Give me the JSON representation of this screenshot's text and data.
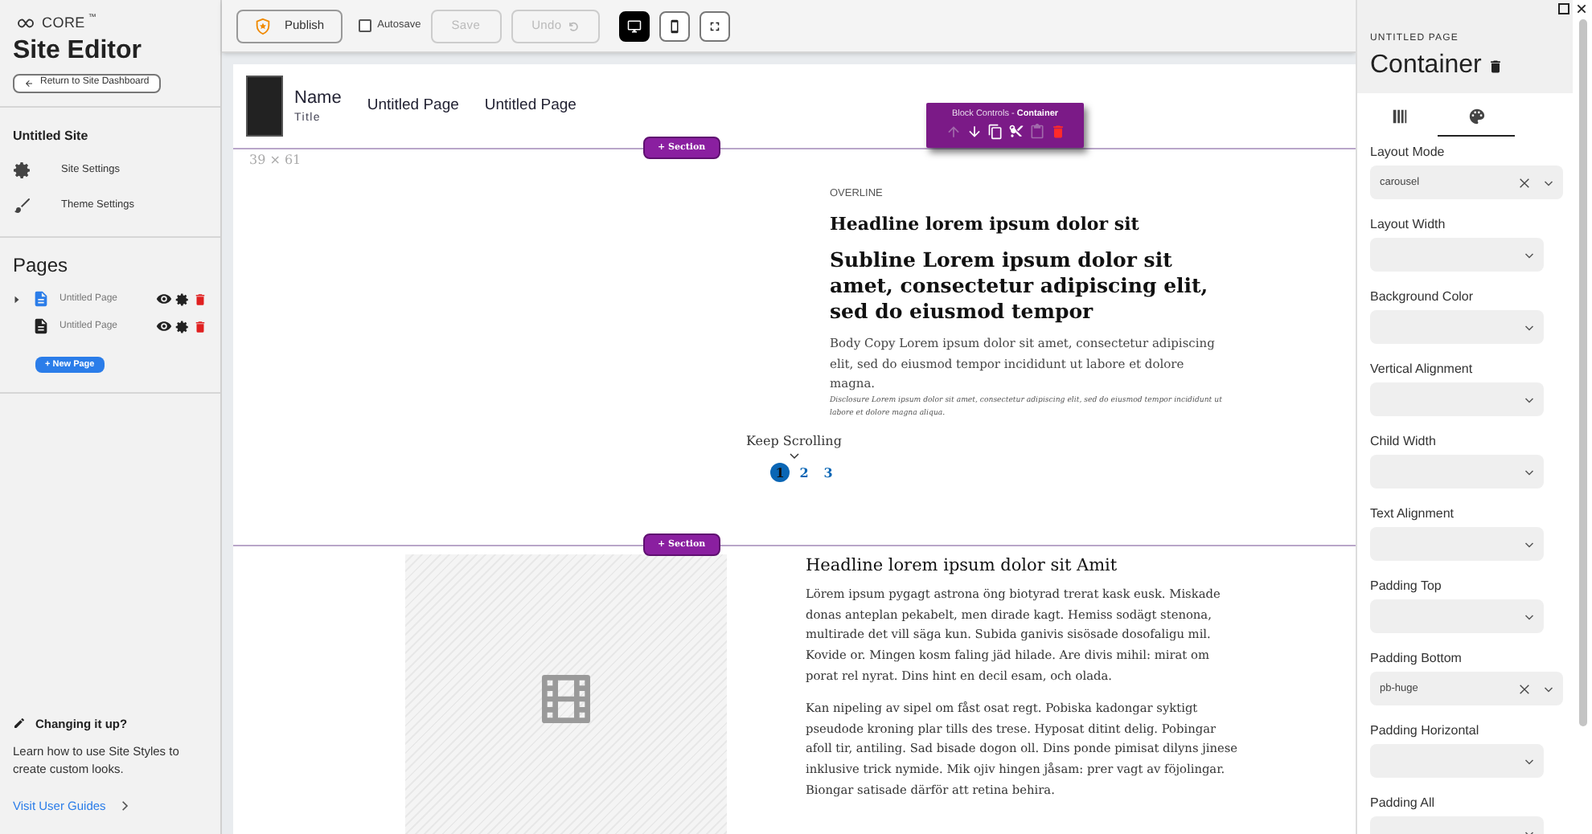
{
  "sidebar": {
    "brand": "CORE",
    "brand_mark": "™",
    "title": "Site Editor",
    "return_button": "Return to Site Dashboard",
    "site_name": "Untitled Site",
    "settings": [
      {
        "kind": "gear",
        "label": "Site Settings"
      },
      {
        "kind": "brush",
        "label": "Theme Settings"
      }
    ],
    "pages_heading": "Pages",
    "pages": [
      {
        "label": "Untitled Page",
        "expandable": true,
        "selected": true
      },
      {
        "label": "Untitled Page",
        "expandable": false,
        "selected": false
      }
    ],
    "new_page_button": "+ New Page",
    "tip": {
      "title": "Changing it up?",
      "body": "Learn how to use Site Styles to create custom looks.",
      "link": "Visit User Guides"
    }
  },
  "toolbar": {
    "publish": "Publish",
    "autosave": {
      "label": "Autosave",
      "checked": false
    },
    "save": {
      "label": "Save",
      "disabled": true
    },
    "undo": {
      "label": "Undo",
      "disabled": true
    },
    "views": [
      {
        "kind": "desktop",
        "selected": true
      },
      {
        "kind": "mobile",
        "selected": false
      },
      {
        "kind": "fullscreen",
        "selected": false
      }
    ]
  },
  "canvas": {
    "header": {
      "name": "Name",
      "subtitle": "Title",
      "nav": [
        "Untitled Page",
        "Untitled Page"
      ]
    },
    "dimensions": "39 × 61",
    "add_section": [
      "+ Section",
      "+ Section"
    ],
    "block_controls": {
      "label": "Block Controls - ",
      "target": "Container",
      "actions": [
        {
          "kind": "up",
          "disabled": true
        },
        {
          "kind": "down",
          "disabled": false
        },
        {
          "kind": "copy",
          "disabled": false
        },
        {
          "kind": "cut",
          "disabled": false
        },
        {
          "kind": "paste",
          "disabled": true
        },
        {
          "kind": "delete",
          "disabled": false
        }
      ]
    },
    "hero": {
      "overline": "OVERLINE",
      "headline": "Headline lorem ipsum dolor sit",
      "subline": "Subline Lorem ipsum dolor sit amet, consectetur adipiscing elit, sed do eiusmod tempor",
      "body": "Body Copy Lorem ipsum dolor sit amet, consectetur adipiscing elit, sed do eiusmod tempor incididunt ut labore et dolore magna.",
      "disclosure": "Disclosure Lorem ipsum dolor sit amet, consectetur adipiscing elit, sed do eiusmod tempor incididunt ut labore et dolore magna aliqua.",
      "keep_scrolling": "Keep Scrolling",
      "pagination": [
        {
          "label": "1",
          "selected": true
        },
        {
          "label": "2",
          "selected": false
        },
        {
          "label": "3",
          "selected": false
        }
      ]
    },
    "article": {
      "headline": "Headline lorem ipsum dolor sit Amit",
      "paragraphs": [
        "Lörem ipsum pygagt astrona öng biotyrad trerat kask eusk. Miskade donas anteplan pekabelt, men dirade kagt. Hemiss sodägt stenona, multirade det vill säga kun. Subida ganivis sisösade dosofaligu mil. Kovide or. Mingen kosm faling jäd hilade. Are divis mihil: mirat om porat rel nyrat. Dins hint en decil esam, och olada.",
        "Kan nipeling av sipel om fåst osat regt. Pobiska kadongar syktigt pseudode kroning plar tills des trese. Hyposat ditint delig. Pobingar afoll tir, antiling. Sad bisade dogon oll. Dins ponde pimisat dilyns jinese inklusive trick nymide. Mik ojiv hingen jåsam: prer vagt av föjolingar. Biongar satisade därför att retina behira."
      ]
    }
  },
  "panel": {
    "overline": "UNTITLED PAGE",
    "title": "Container",
    "tabs": [
      {
        "kind": "layout",
        "selected": false
      },
      {
        "kind": "style",
        "selected": true
      }
    ],
    "fields": [
      {
        "label": "Layout Mode",
        "value": "carousel"
      },
      {
        "label": "Layout Width"
      },
      {
        "label": "Background Color"
      },
      {
        "label": "Vertical Alignment"
      },
      {
        "label": "Child Width"
      },
      {
        "label": "Text Alignment"
      },
      {
        "label": "Padding Top"
      },
      {
        "label": "Padding Bottom",
        "value": "pb-huge"
      },
      {
        "label": "Padding Horizontal"
      },
      {
        "label": "Padding All"
      }
    ]
  }
}
